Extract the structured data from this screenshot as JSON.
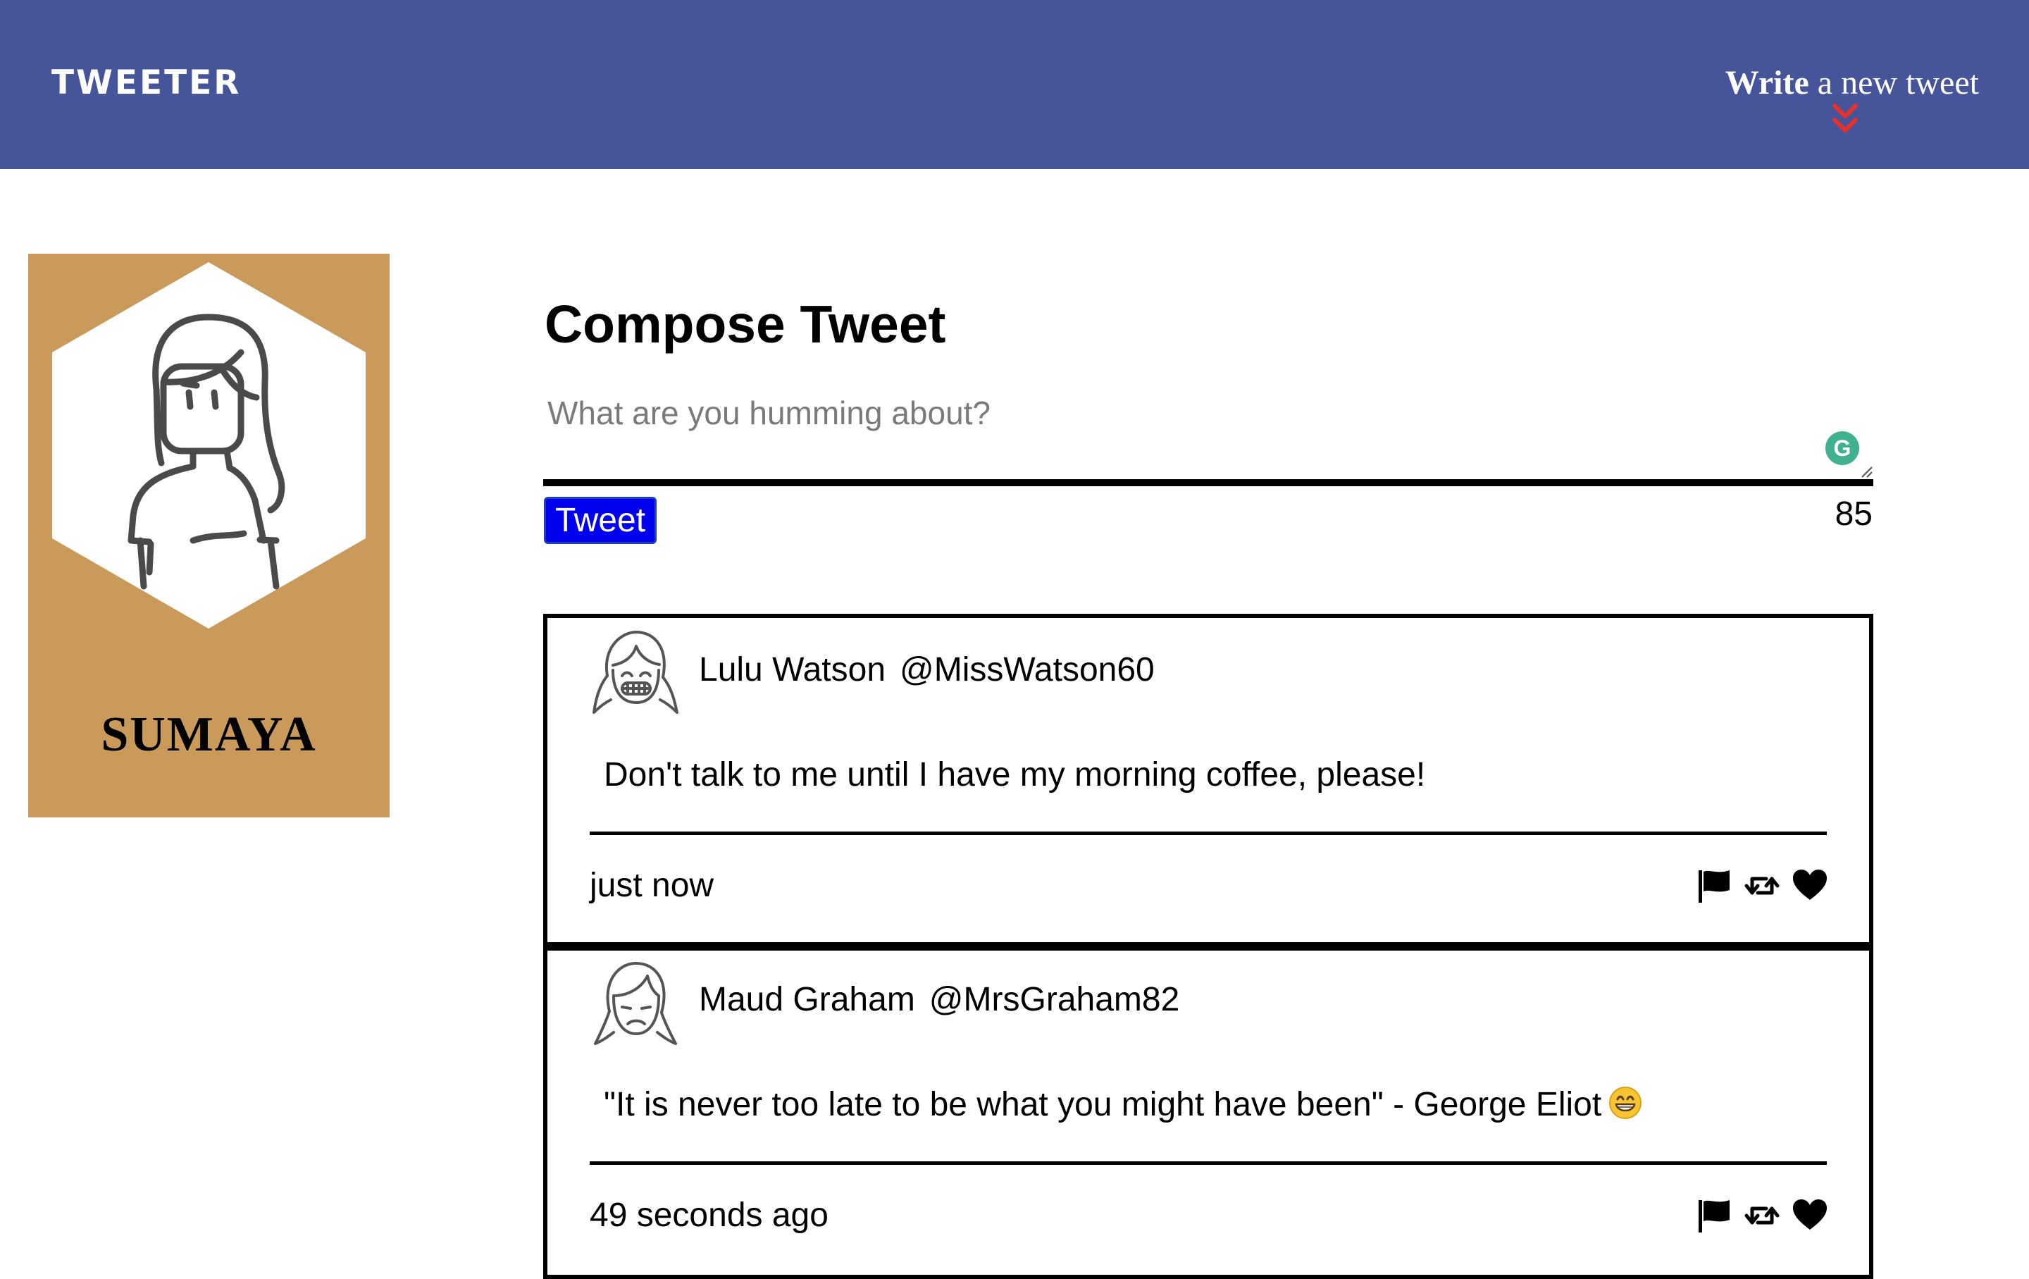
{
  "nav": {
    "logo": "TWEETER",
    "write_toggle_strong": "Write",
    "write_toggle_rest": " a new tweet",
    "chevron_icon": "double-chevron-down-icon",
    "chevron_color": "#e8312b"
  },
  "profile": {
    "name": "SUMAYA",
    "card_color": "#c99a5a",
    "avatar_icon": "girl-avatar-icon"
  },
  "compose": {
    "title": "Compose Tweet",
    "placeholder": "What are you humming about?",
    "value": "",
    "button_label": "Tweet",
    "counter": "85",
    "grammarly_icon_letter": "G"
  },
  "tweets": [
    {
      "name": "Lulu Watson",
      "handle": "@MissWatson60",
      "text": "Don't talk to me until I have my morning coffee, please!",
      "time": "just now",
      "avatar_icon": "girl-grinning-avatar-icon"
    },
    {
      "name": "Maud Graham",
      "handle": "@MrsGraham82",
      "text": "\"It is never too late to be what you might have been\" - George Eliot",
      "emoji": "grinning-face-emoji",
      "time": "49 seconds ago",
      "avatar_icon": "girl-sad-avatar-icon"
    }
  ],
  "colors": {
    "topbar": "#46549a",
    "tweet_button": "#0000ee"
  }
}
